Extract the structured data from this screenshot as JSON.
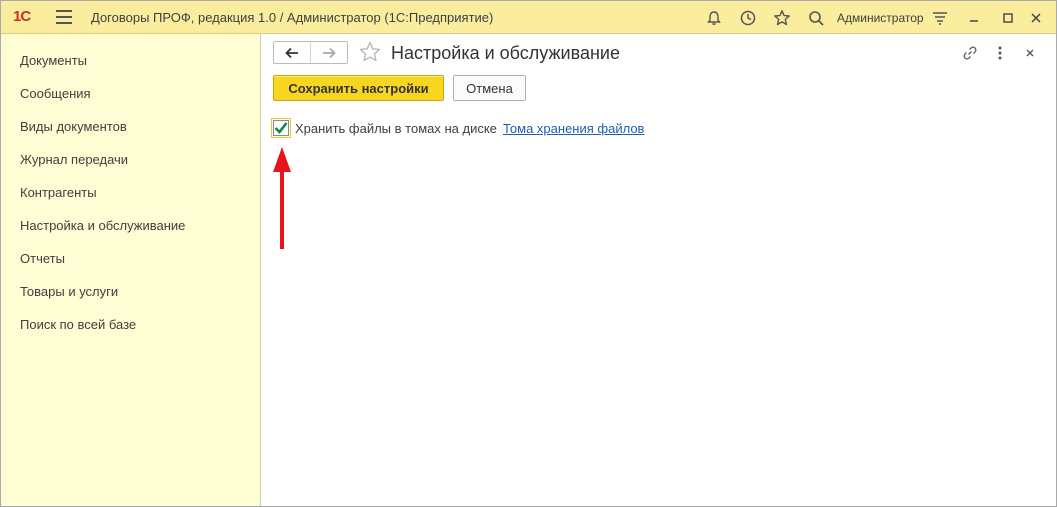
{
  "titlebar": {
    "logo": "1С",
    "title": "Договоры ПРОФ, редакция 1.0 / Администратор  (1С:Предприятие)",
    "user": "Администратор",
    "icons": [
      "bell-icon",
      "history-icon",
      "star-icon",
      "search-icon",
      "menu-icon",
      "minimize-icon",
      "maximize-icon",
      "close-icon"
    ]
  },
  "sidebar": {
    "items": [
      {
        "label": "Документы",
        "bold": true
      },
      {
        "label": "Сообщения",
        "bold": true
      },
      {
        "label": "Виды документов",
        "bold": false
      },
      {
        "label": "Журнал передачи",
        "bold": false
      },
      {
        "label": "Контрагенты",
        "bold": false
      },
      {
        "label": "Настройка и обслуживание",
        "bold": false
      },
      {
        "label": "Отчеты",
        "bold": false
      },
      {
        "label": "Товары и услуги",
        "bold": false
      },
      {
        "label": "Поиск по всей базе",
        "bold": false
      }
    ]
  },
  "form": {
    "title": "Настройка и обслуживание",
    "save_label": "Сохранить настройки",
    "cancel_label": "Отмена",
    "checkbox_label": "Хранить файлы в томах на диске",
    "checkbox_checked": true,
    "link_label": "Тома хранения файлов"
  },
  "colors": {
    "titlebar_bg": "#fbed9e",
    "sidebar_bg": "#fefdd4",
    "primary_button": "#f7d521",
    "link": "#1a5fb4",
    "check": "#0e8a4a",
    "arrow": "#e8141c"
  }
}
